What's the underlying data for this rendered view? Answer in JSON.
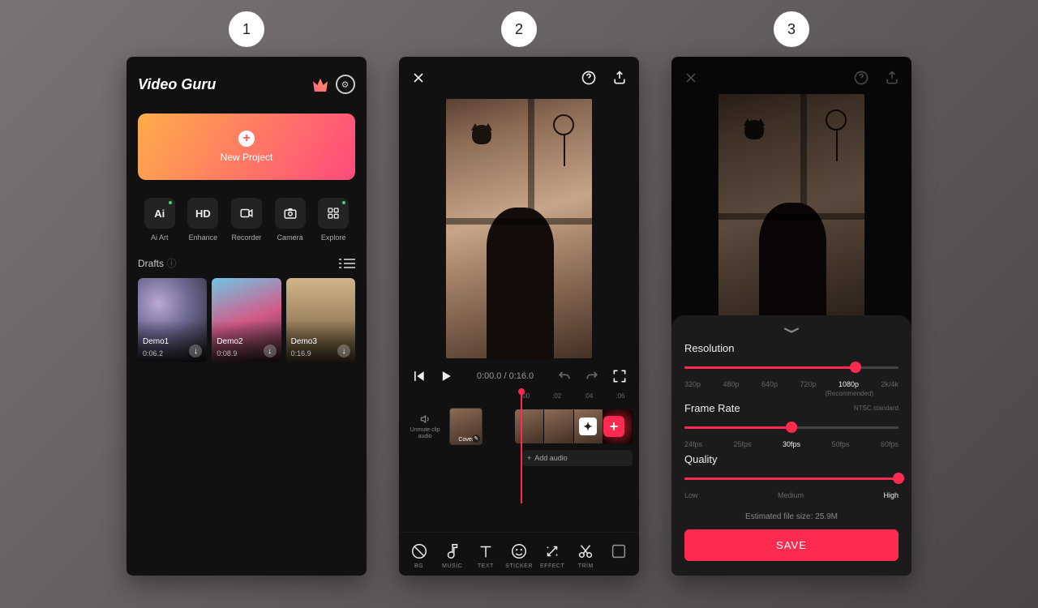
{
  "steps": [
    "1",
    "2",
    "3"
  ],
  "s1": {
    "logo": "Video Guru",
    "new_project": "New Project",
    "tools": [
      {
        "icon": "Ai",
        "label": "Ai Art"
      },
      {
        "icon": "HD",
        "label": "Enhance"
      },
      {
        "icon": "rec",
        "label": "Recorder"
      },
      {
        "icon": "cam",
        "label": "Camera"
      },
      {
        "icon": "grid",
        "label": "Explore"
      }
    ],
    "drafts_title": "Drafts",
    "drafts": [
      {
        "name": "Demo1",
        "dur": "0:06.2"
      },
      {
        "name": "Demo2",
        "dur": "0:08.9"
      },
      {
        "name": "Demo3",
        "dur": "0:16.9"
      }
    ]
  },
  "s2": {
    "time": "0:00.0 / 0:16.0",
    "ruler": [
      ":00",
      ":02",
      ":04",
      ":06"
    ],
    "unmute_label": "Unmute clip audio",
    "cover_label": "Cover",
    "add_audio_label": "Add audio",
    "bottom_tools": [
      {
        "name": "bg",
        "label": "BG"
      },
      {
        "name": "music",
        "label": "MUSIC"
      },
      {
        "name": "text",
        "label": "TEXT"
      },
      {
        "name": "sticker",
        "label": "STICKER"
      },
      {
        "name": "effect",
        "label": "EFFECT"
      },
      {
        "name": "trim",
        "label": "TRIM"
      },
      {
        "name": "more",
        "label": ""
      }
    ]
  },
  "s3": {
    "resolution": {
      "title": "Resolution",
      "options": [
        "320p",
        "480p",
        "640p",
        "720p",
        "1080p",
        "2k/4k"
      ],
      "active": 4,
      "reco": "(Recommended)",
      "pct": 80
    },
    "framerate": {
      "title": "Frame Rate",
      "note": "NTSC standard",
      "options": [
        "24fps",
        "25fps",
        "30fps",
        "50fps",
        "60fps"
      ],
      "active": 2,
      "pct": 50
    },
    "quality": {
      "title": "Quality",
      "options": [
        "Low",
        "Medium",
        "High"
      ],
      "active": 2,
      "pct": 100
    },
    "estimate": "Estimated file size: 25.9M",
    "save": "SAVE"
  }
}
